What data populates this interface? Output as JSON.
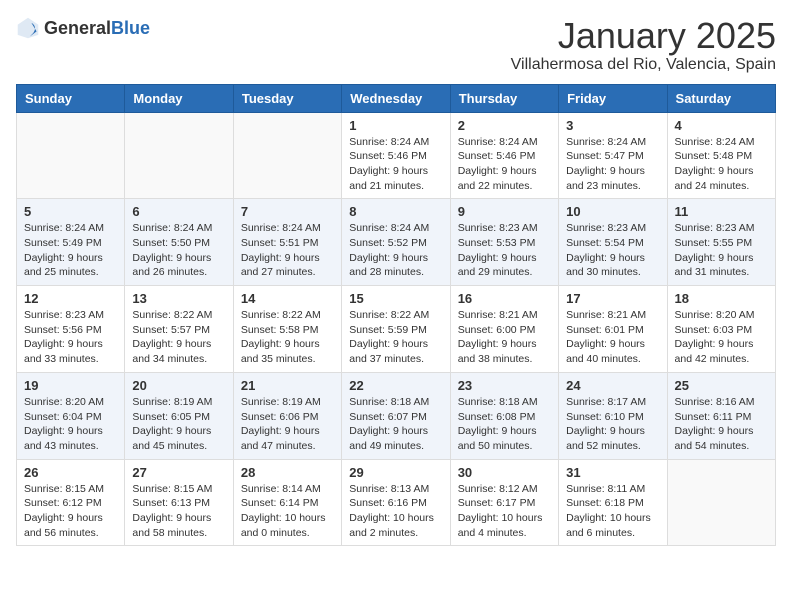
{
  "header": {
    "logo_general": "General",
    "logo_blue": "Blue",
    "month_title": "January 2025",
    "location": "Villahermosa del Rio, Valencia, Spain"
  },
  "weekdays": [
    "Sunday",
    "Monday",
    "Tuesday",
    "Wednesday",
    "Thursday",
    "Friday",
    "Saturday"
  ],
  "weeks": [
    [
      {
        "day": "",
        "info": ""
      },
      {
        "day": "",
        "info": ""
      },
      {
        "day": "",
        "info": ""
      },
      {
        "day": "1",
        "info": "Sunrise: 8:24 AM\nSunset: 5:46 PM\nDaylight: 9 hours\nand 21 minutes."
      },
      {
        "day": "2",
        "info": "Sunrise: 8:24 AM\nSunset: 5:46 PM\nDaylight: 9 hours\nand 22 minutes."
      },
      {
        "day": "3",
        "info": "Sunrise: 8:24 AM\nSunset: 5:47 PM\nDaylight: 9 hours\nand 23 minutes."
      },
      {
        "day": "4",
        "info": "Sunrise: 8:24 AM\nSunset: 5:48 PM\nDaylight: 9 hours\nand 24 minutes."
      }
    ],
    [
      {
        "day": "5",
        "info": "Sunrise: 8:24 AM\nSunset: 5:49 PM\nDaylight: 9 hours\nand 25 minutes."
      },
      {
        "day": "6",
        "info": "Sunrise: 8:24 AM\nSunset: 5:50 PM\nDaylight: 9 hours\nand 26 minutes."
      },
      {
        "day": "7",
        "info": "Sunrise: 8:24 AM\nSunset: 5:51 PM\nDaylight: 9 hours\nand 27 minutes."
      },
      {
        "day": "8",
        "info": "Sunrise: 8:24 AM\nSunset: 5:52 PM\nDaylight: 9 hours\nand 28 minutes."
      },
      {
        "day": "9",
        "info": "Sunrise: 8:23 AM\nSunset: 5:53 PM\nDaylight: 9 hours\nand 29 minutes."
      },
      {
        "day": "10",
        "info": "Sunrise: 8:23 AM\nSunset: 5:54 PM\nDaylight: 9 hours\nand 30 minutes."
      },
      {
        "day": "11",
        "info": "Sunrise: 8:23 AM\nSunset: 5:55 PM\nDaylight: 9 hours\nand 31 minutes."
      }
    ],
    [
      {
        "day": "12",
        "info": "Sunrise: 8:23 AM\nSunset: 5:56 PM\nDaylight: 9 hours\nand 33 minutes."
      },
      {
        "day": "13",
        "info": "Sunrise: 8:22 AM\nSunset: 5:57 PM\nDaylight: 9 hours\nand 34 minutes."
      },
      {
        "day": "14",
        "info": "Sunrise: 8:22 AM\nSunset: 5:58 PM\nDaylight: 9 hours\nand 35 minutes."
      },
      {
        "day": "15",
        "info": "Sunrise: 8:22 AM\nSunset: 5:59 PM\nDaylight: 9 hours\nand 37 minutes."
      },
      {
        "day": "16",
        "info": "Sunrise: 8:21 AM\nSunset: 6:00 PM\nDaylight: 9 hours\nand 38 minutes."
      },
      {
        "day": "17",
        "info": "Sunrise: 8:21 AM\nSunset: 6:01 PM\nDaylight: 9 hours\nand 40 minutes."
      },
      {
        "day": "18",
        "info": "Sunrise: 8:20 AM\nSunset: 6:03 PM\nDaylight: 9 hours\nand 42 minutes."
      }
    ],
    [
      {
        "day": "19",
        "info": "Sunrise: 8:20 AM\nSunset: 6:04 PM\nDaylight: 9 hours\nand 43 minutes."
      },
      {
        "day": "20",
        "info": "Sunrise: 8:19 AM\nSunset: 6:05 PM\nDaylight: 9 hours\nand 45 minutes."
      },
      {
        "day": "21",
        "info": "Sunrise: 8:19 AM\nSunset: 6:06 PM\nDaylight: 9 hours\nand 47 minutes."
      },
      {
        "day": "22",
        "info": "Sunrise: 8:18 AM\nSunset: 6:07 PM\nDaylight: 9 hours\nand 49 minutes."
      },
      {
        "day": "23",
        "info": "Sunrise: 8:18 AM\nSunset: 6:08 PM\nDaylight: 9 hours\nand 50 minutes."
      },
      {
        "day": "24",
        "info": "Sunrise: 8:17 AM\nSunset: 6:10 PM\nDaylight: 9 hours\nand 52 minutes."
      },
      {
        "day": "25",
        "info": "Sunrise: 8:16 AM\nSunset: 6:11 PM\nDaylight: 9 hours\nand 54 minutes."
      }
    ],
    [
      {
        "day": "26",
        "info": "Sunrise: 8:15 AM\nSunset: 6:12 PM\nDaylight: 9 hours\nand 56 minutes."
      },
      {
        "day": "27",
        "info": "Sunrise: 8:15 AM\nSunset: 6:13 PM\nDaylight: 9 hours\nand 58 minutes."
      },
      {
        "day": "28",
        "info": "Sunrise: 8:14 AM\nSunset: 6:14 PM\nDaylight: 10 hours\nand 0 minutes."
      },
      {
        "day": "29",
        "info": "Sunrise: 8:13 AM\nSunset: 6:16 PM\nDaylight: 10 hours\nand 2 minutes."
      },
      {
        "day": "30",
        "info": "Sunrise: 8:12 AM\nSunset: 6:17 PM\nDaylight: 10 hours\nand 4 minutes."
      },
      {
        "day": "31",
        "info": "Sunrise: 8:11 AM\nSunset: 6:18 PM\nDaylight: 10 hours\nand 6 minutes."
      },
      {
        "day": "",
        "info": ""
      }
    ]
  ]
}
